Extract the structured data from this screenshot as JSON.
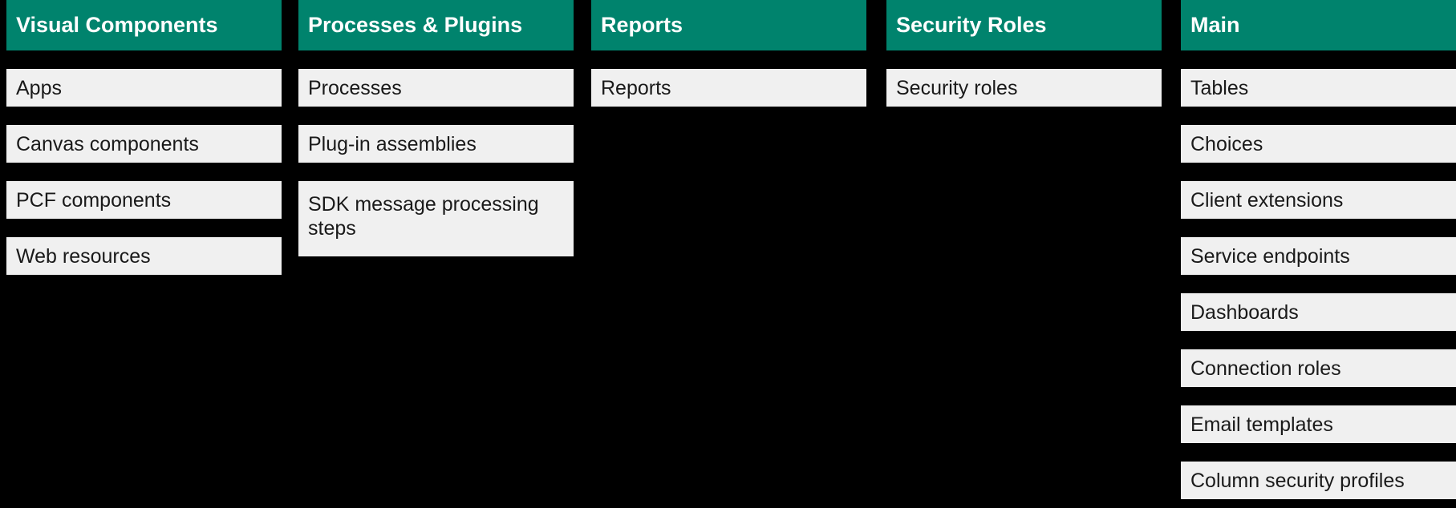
{
  "theme": {
    "background": "#000000",
    "header_fill": "#00836D",
    "header_text": "#FFFFFF",
    "cell_fill": "#F0F0F0",
    "cell_text": "#1A1A1A"
  },
  "columns": [
    {
      "header": "Visual Components",
      "items": [
        {
          "label": "Apps",
          "two_line": false
        },
        {
          "label": "Canvas components",
          "two_line": false
        },
        {
          "label": "PCF components",
          "two_line": false
        },
        {
          "label": "Web resources",
          "two_line": false
        }
      ]
    },
    {
      "header": "Processes & Plugins",
      "items": [
        {
          "label": "Processes",
          "two_line": false
        },
        {
          "label": "Plug-in assemblies",
          "two_line": false
        },
        {
          "label": "SDK message processing steps",
          "two_line": true
        }
      ]
    },
    {
      "header": "Reports",
      "items": [
        {
          "label": "Reports",
          "two_line": false
        }
      ]
    },
    {
      "header": "Security Roles",
      "items": [
        {
          "label": "Security roles",
          "two_line": false
        }
      ]
    },
    {
      "header": "Main",
      "items": [
        {
          "label": "Tables",
          "two_line": false
        },
        {
          "label": "Choices",
          "two_line": false
        },
        {
          "label": "Client extensions",
          "two_line": false
        },
        {
          "label": "Service endpoints",
          "two_line": false
        },
        {
          "label": "Dashboards",
          "two_line": false
        },
        {
          "label": "Connection roles",
          "two_line": false
        },
        {
          "label": "Email templates",
          "two_line": false
        },
        {
          "label": "Column security profiles",
          "two_line": false
        }
      ]
    }
  ]
}
